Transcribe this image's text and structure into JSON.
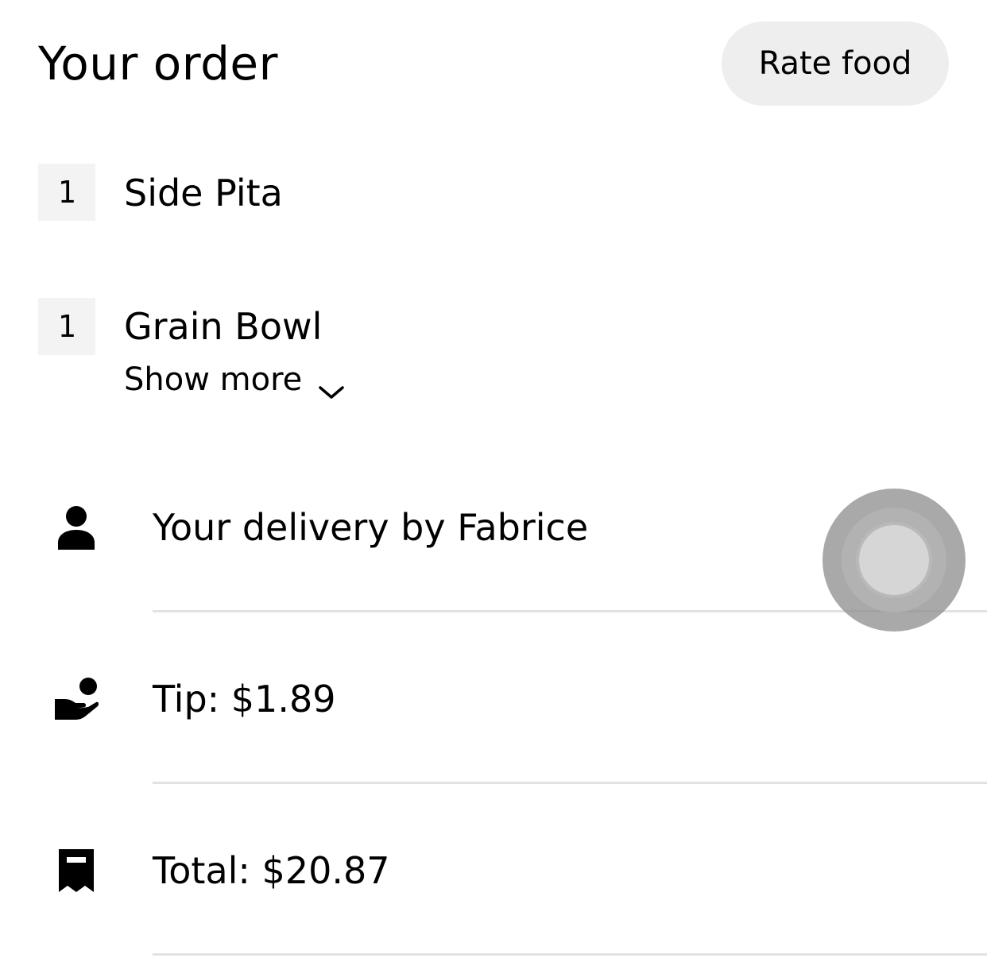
{
  "header": {
    "title": "Your order",
    "rate_button_label": "Rate food"
  },
  "items": [
    {
      "quantity": "1",
      "name": "Side Pita"
    },
    {
      "quantity": "1",
      "name": "Grain Bowl",
      "show_more_label": "Show more"
    }
  ],
  "details": {
    "delivery": {
      "icon": "person-icon",
      "text": "Your delivery by Fabrice"
    },
    "tip": {
      "icon": "tip-hand-icon",
      "text": "Tip: $1.89"
    },
    "total": {
      "icon": "receipt-icon",
      "text": "Total: $20.87"
    }
  },
  "colors": {
    "button_bg": "#eeeeee",
    "quantity_bg": "#f3f3f3",
    "divider": "#e2e2e2",
    "text": "#000000"
  }
}
